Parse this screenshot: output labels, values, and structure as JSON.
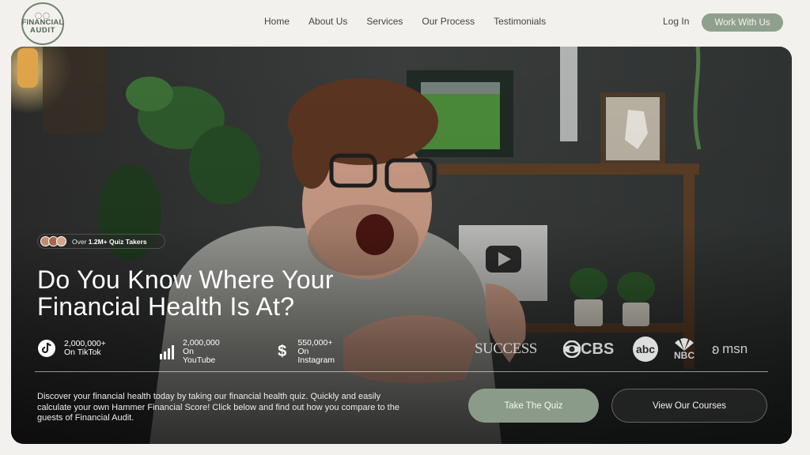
{
  "nav": {
    "logo_line1": "FINANCIAL",
    "logo_line2": "AUDIT",
    "items": [
      "Home",
      "About Us",
      "Services",
      "Our Process",
      "Testimonials"
    ],
    "login": "Log In",
    "cta": "Work With Us"
  },
  "hero": {
    "badge_prefix": "Over ",
    "badge_strong": "1.2M+ Quiz Takers",
    "headline_line1": "Do You Know Where Your",
    "headline_line2": "Financial Health Is At?",
    "stats": [
      {
        "value": "2,000,000+",
        "label": "On TikTok",
        "icon": "tiktok-icon"
      },
      {
        "value": "2,000,000",
        "label": "On YouTube",
        "icon": "signal-bars-icon"
      },
      {
        "value": "550,000+",
        "label": "On Instagram",
        "icon": "dollar-icon"
      }
    ],
    "press": [
      "SUCCESS",
      "CBS",
      "abc",
      "NBC",
      "msn"
    ],
    "description": "Discover your financial health today by taking our financial health quiz. Quickly and easily calculate your own Hammer Financial Score! Click below and find out how you compare to the guests of Financial Audit.",
    "quiz_button": "Take The Quiz",
    "courses_button": "View Our Courses"
  },
  "colors": {
    "accent": "#8fa08e",
    "page_bg": "#f3f1ed"
  }
}
